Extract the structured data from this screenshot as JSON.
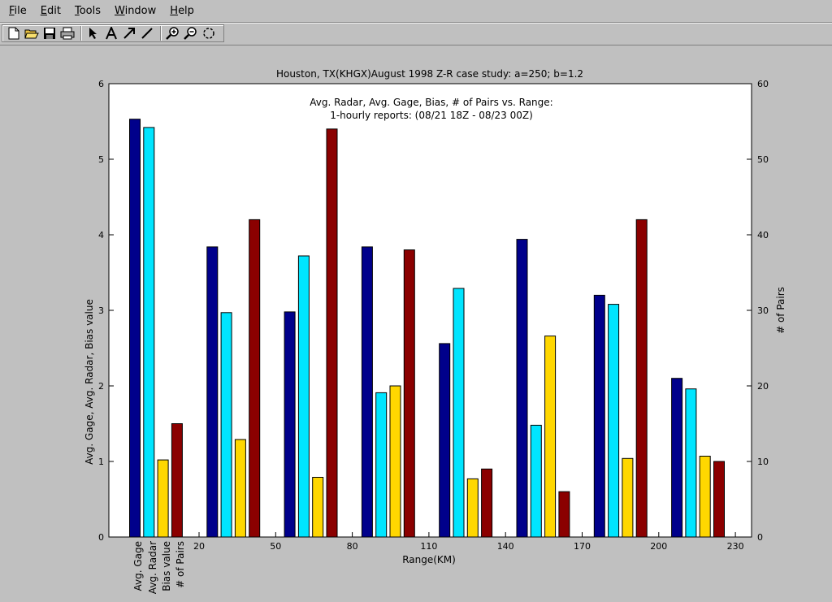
{
  "menu": {
    "items": [
      {
        "prefix": "",
        "ul": "F",
        "rest": "ile"
      },
      {
        "prefix": "",
        "ul": "E",
        "rest": "dit"
      },
      {
        "prefix": "",
        "ul": "T",
        "rest": "ools"
      },
      {
        "prefix": "",
        "ul": "W",
        "rest": "indow"
      },
      {
        "prefix": "",
        "ul": "H",
        "rest": "elp"
      }
    ]
  },
  "toolbar": {
    "icons": [
      "new-figure-icon",
      "open-file-icon",
      "save-icon",
      "print-icon",
      "arrow-select-icon",
      "insert-text-icon",
      "insert-arrow-icon",
      "insert-line-icon",
      "zoom-in-icon",
      "zoom-out-icon",
      "rotate-3d-icon"
    ]
  },
  "chart_data": {
    "type": "bar",
    "title": "Houston, TX(KHGX)August 1998 Z-R case study: a=250; b=1.2",
    "annotation": [
      "Avg. Radar, Avg. Gage, Bias, # of Pairs vs. Range:",
      "1-hourly reports: (08/21 18Z - 08/23 00Z)"
    ],
    "xlabel": "Range(KM)",
    "ylabel_left": "Avg. Gage, Avg. Radar, Bias value",
    "ylabel_right": "# of Pairs",
    "x_tick_labels": [
      "20",
      "50",
      "80",
      "110",
      "140",
      "170",
      "200",
      "230"
    ],
    "ylim_left": [
      0,
      6
    ],
    "ylim_right": [
      0,
      60
    ],
    "y_ticks_left": [
      0,
      1,
      2,
      3,
      4,
      5,
      6
    ],
    "y_ticks_right": [
      0,
      10,
      20,
      30,
      40,
      50,
      60
    ],
    "legend_labels": [
      "Avg. Gage",
      "Avg. Radar",
      "Bias value",
      "# of Pairs"
    ],
    "series": [
      {
        "name": "Avg. Gage",
        "color": "#00008b",
        "axis": "left",
        "values": [
          5.53,
          3.84,
          2.98,
          3.84,
          2.56,
          3.94,
          3.2,
          2.1
        ]
      },
      {
        "name": "Avg. Radar",
        "color": "#00e5ff",
        "axis": "left",
        "values": [
          5.42,
          2.97,
          3.72,
          1.91,
          3.29,
          1.48,
          3.08,
          1.96
        ]
      },
      {
        "name": "Bias value",
        "color": "#ffd700",
        "axis": "left",
        "values": [
          1.02,
          1.29,
          0.79,
          2.0,
          0.77,
          2.66,
          1.04,
          1.07
        ]
      },
      {
        "name": "# of Pairs",
        "color": "#8b0000",
        "axis": "right",
        "values": [
          15,
          42,
          54,
          38,
          9,
          6,
          42,
          10
        ]
      }
    ],
    "grid": false,
    "legend_position": "bottom-left, vertical rotated labels"
  }
}
